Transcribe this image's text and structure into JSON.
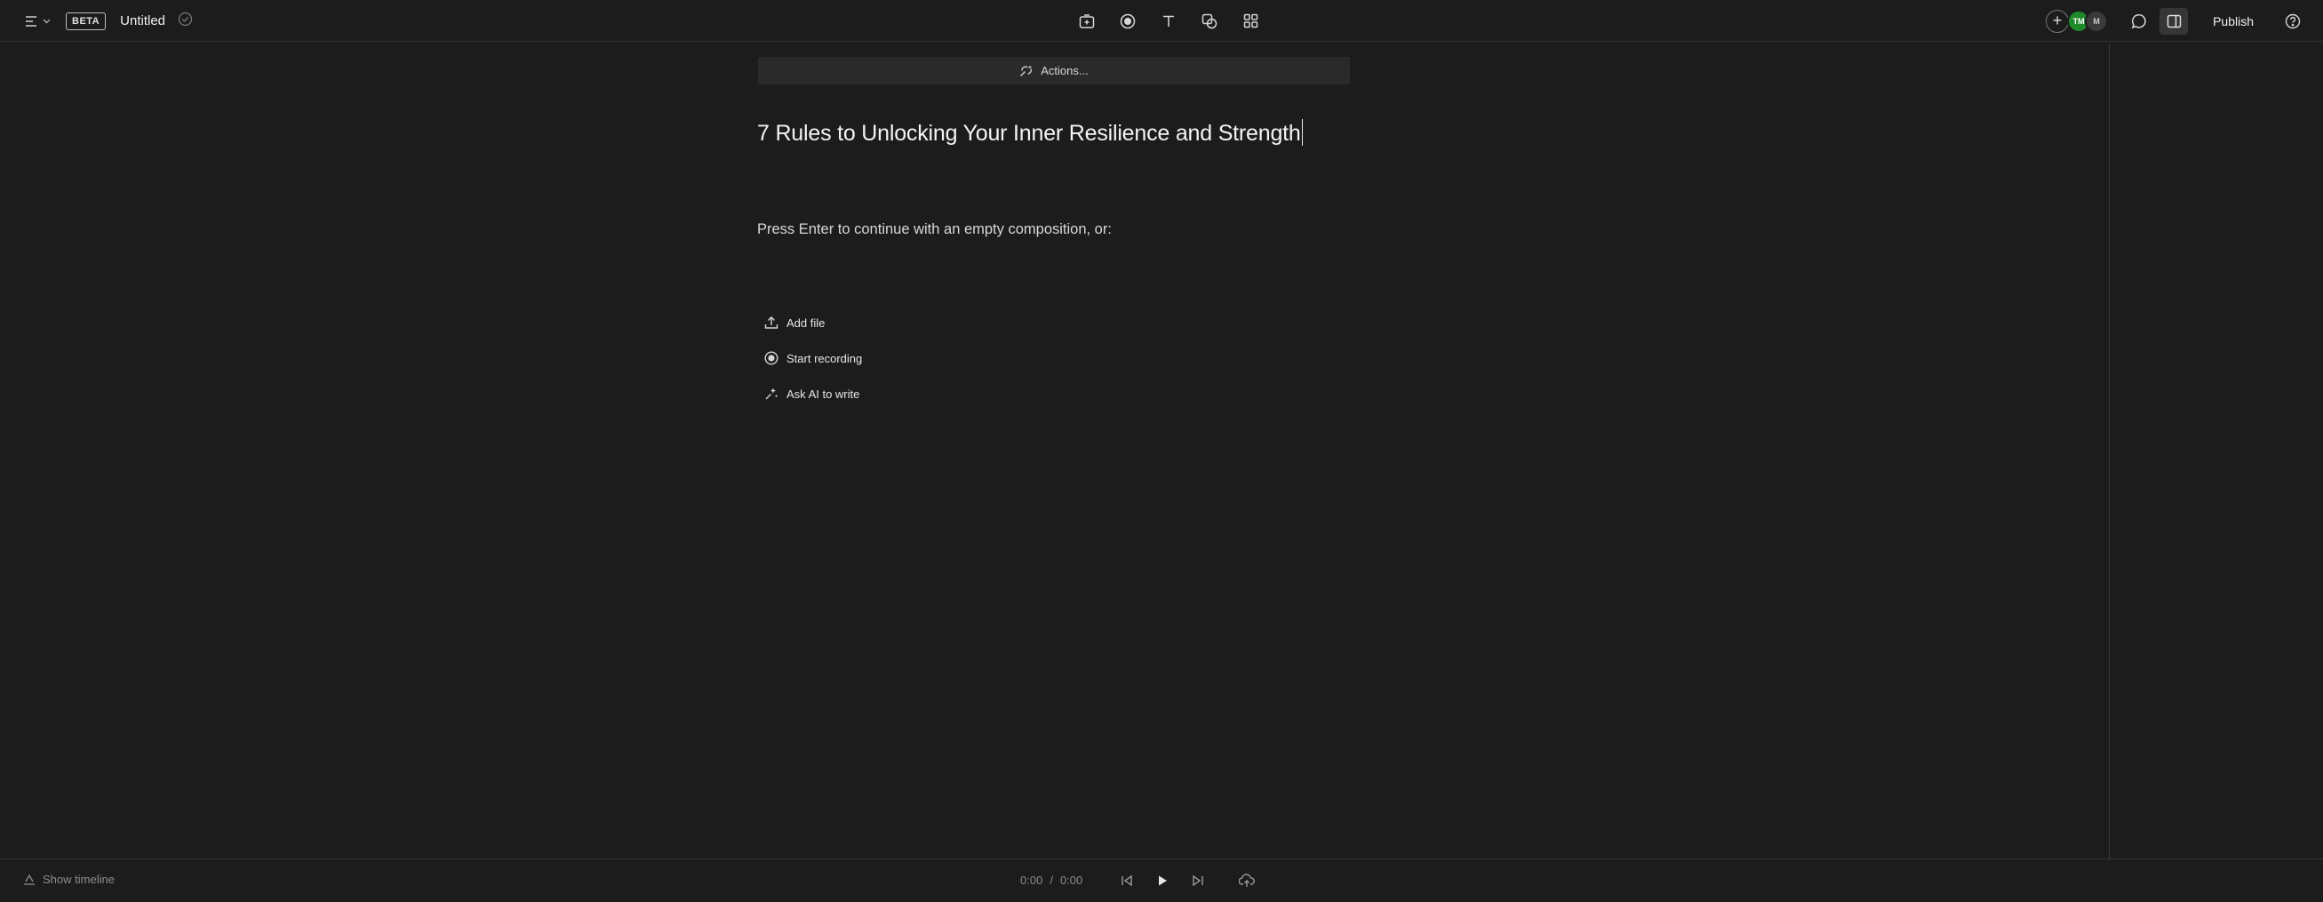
{
  "topbar": {
    "beta_badge": "BETA",
    "doc_title": "Untitled",
    "publish_label": "Publish",
    "avatars": [
      {
        "initials": "TM",
        "color": "#1f8a2b"
      },
      {
        "initials": "M",
        "color": "#3a3a3a"
      }
    ],
    "tools": [
      "add-scene-icon",
      "record-icon",
      "text-icon",
      "shapes-icon",
      "grid-icon"
    ]
  },
  "main": {
    "actions_label": "Actions...",
    "composition_title": "7 Rules to Unlocking Your Inner Resilience and Strength",
    "hint": "Press Enter to continue with an empty composition, or:",
    "options": [
      {
        "label": "Add file",
        "icon": "upload-icon"
      },
      {
        "label": "Start recording",
        "icon": "record-icon"
      },
      {
        "label": "Ask AI to write",
        "icon": "sparkle-icon"
      }
    ]
  },
  "bottombar": {
    "timeline_label": "Show timeline",
    "current_time": "0:00",
    "time_separator": "/",
    "total_time": "0:00"
  },
  "colors": {
    "background": "#1c1c1c",
    "avatar_green": "#1f8a2b",
    "actions_bar": "#2a2a2a"
  }
}
